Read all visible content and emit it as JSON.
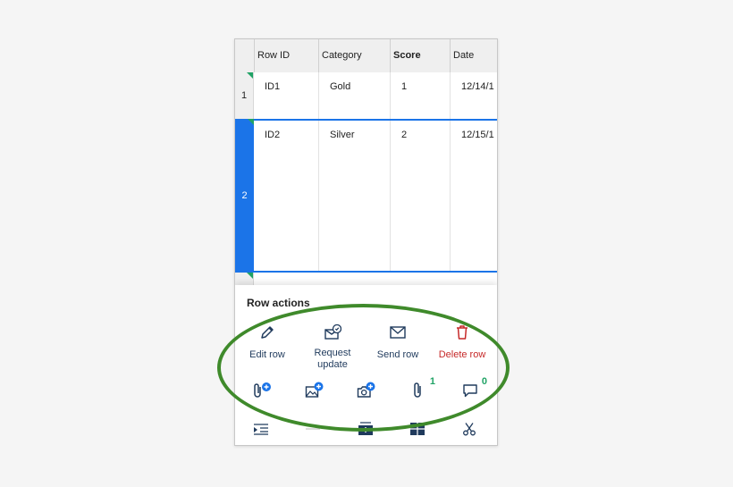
{
  "grid": {
    "columns": [
      "Row ID",
      "Category",
      "Score",
      "Date"
    ],
    "rows": [
      {
        "number": "1",
        "id": "ID1",
        "category": "Gold",
        "score": "1",
        "date": "12/14/1"
      },
      {
        "number": "2",
        "id": "ID2",
        "category": "Silver",
        "score": "2",
        "date": "12/15/1"
      }
    ],
    "selected_row": "2"
  },
  "row_actions": {
    "title": "Row actions",
    "actions": [
      {
        "label": "Edit row",
        "icon": "pencil-icon"
      },
      {
        "label": "Request\nupdate",
        "icon": "request-update-icon"
      },
      {
        "label": "Send row",
        "icon": "envelope-icon"
      },
      {
        "label": "Delete row",
        "icon": "trash-icon"
      }
    ],
    "attachments": [
      {
        "icon": "attach-file-plus-icon"
      },
      {
        "icon": "attach-image-plus-icon"
      },
      {
        "icon": "camera-plus-icon"
      },
      {
        "icon": "paperclip-icon",
        "count": "1"
      },
      {
        "icon": "comment-icon",
        "count": "0"
      }
    ]
  },
  "navbar": {
    "items": [
      "indent-icon",
      "outdent-icon",
      "insert-row-icon",
      "insert-grid-icon",
      "scissors-icon"
    ]
  },
  "colors": {
    "selection": "#1b74e8",
    "accent_green": "#21a366",
    "delete_red": "#c62828",
    "icon_navy": "#1f3a5c",
    "highlight_ellipse": "#3f8a2b"
  }
}
